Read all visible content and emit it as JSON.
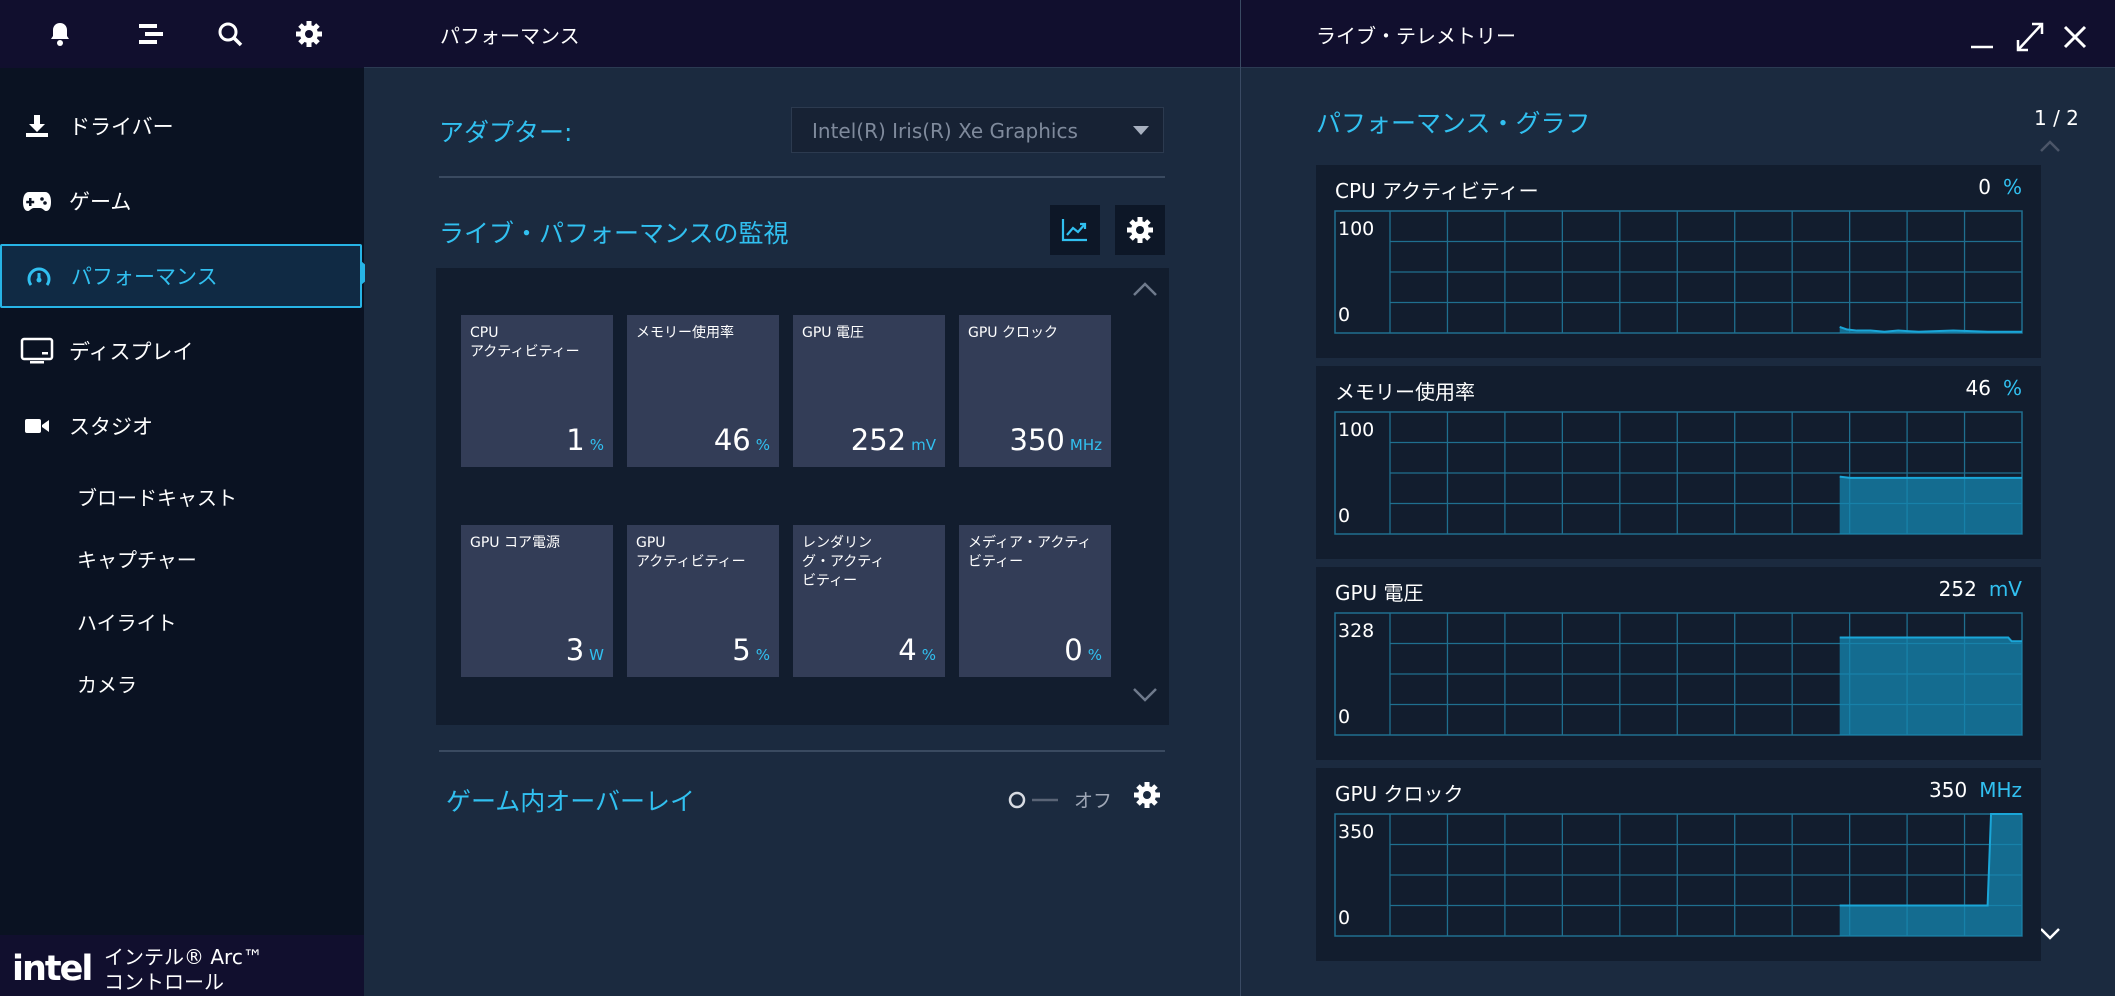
{
  "top_icons": [
    "bell-icon",
    "menu-icon",
    "search-icon",
    "gear-icon"
  ],
  "sidebar": {
    "items": [
      {
        "label": "ドライバー",
        "icon": "download-icon"
      },
      {
        "label": "ゲーム",
        "icon": "gamepad-icon"
      },
      {
        "label": "パフォーマンス",
        "icon": "gauge-icon",
        "active": true
      },
      {
        "label": "ディスプレイ",
        "icon": "monitor-icon"
      },
      {
        "label": "スタジオ",
        "icon": "camera-icon"
      }
    ],
    "sub_items": [
      "ブロードキャスト",
      "キャプチャー",
      "ハイライト",
      "カメラ"
    ],
    "brand": {
      "logo": "intel",
      "line1": "インテル® Arc™",
      "line2": "コントロール"
    }
  },
  "middle": {
    "header_title": "パフォーマンス",
    "adapter_label": "アダプター:",
    "adapter_value": "Intel(R) Iris(R) Xe Graphics",
    "monitor_title": "ライブ・パフォーマンスの監視",
    "tiles": [
      {
        "label": "CPU\nアクティビティー",
        "value": "1",
        "unit": "%"
      },
      {
        "label": "メモリー使用率",
        "value": "46",
        "unit": "%"
      },
      {
        "label": "GPU 電圧",
        "value": "252",
        "unit": "mV"
      },
      {
        "label": "GPU クロック",
        "value": "350",
        "unit": "MHz"
      },
      {
        "label": "GPU コア電源",
        "value": "3",
        "unit": "W"
      },
      {
        "label": "GPU\nアクティビティー",
        "value": "5",
        "unit": "%"
      },
      {
        "label": "レンダリン\nグ・アクティ\nビティー",
        "value": "4",
        "unit": "%"
      },
      {
        "label": "メディア・アクティ\nビティー",
        "value": "0",
        "unit": "%"
      }
    ],
    "overlay_title": "ゲーム内オーバーレイ",
    "overlay_state": "オフ"
  },
  "right": {
    "header_title": "ライブ・テレメトリー",
    "graph_title": "パフォーマンス・グラフ",
    "page_indicator": "1 / 2"
  },
  "colors": {
    "accent": "#31c0f0",
    "sidebar_bg": "#0a1222",
    "header_bg": "#110f2e",
    "panel_bg": "#1b2a3f",
    "tile_bg": "#333d57",
    "card_bg": "#121d2e",
    "grid": "#1f6f8f",
    "fill": "#1687b1"
  },
  "chart_data": [
    {
      "type": "area",
      "title": "CPU アクティビティー",
      "current": "0",
      "unit": "%",
      "ylim": [
        0,
        100
      ],
      "yticks": [
        "100",
        "0"
      ],
      "grid": true,
      "x": [
        0.735,
        0.745,
        0.76,
        0.78,
        0.8,
        0.82,
        0.85,
        0.9,
        0.95,
        1.0
      ],
      "values": [
        5,
        3,
        2,
        2,
        1,
        2,
        1,
        2,
        1,
        1
      ]
    },
    {
      "type": "area",
      "title": "メモリー使用率",
      "current": "46",
      "unit": "%",
      "ylim": [
        0,
        100
      ],
      "yticks": [
        "100",
        "0"
      ],
      "grid": true,
      "x": [
        0.735,
        0.75,
        1.0
      ],
      "values": [
        47,
        46,
        46
      ]
    },
    {
      "type": "area",
      "title": "GPU 電圧",
      "current": "252",
      "unit": "mV",
      "ylim": [
        0,
        328
      ],
      "yticks": [
        "328",
        "0"
      ],
      "grid": true,
      "x": [
        0.735,
        0.98,
        0.985,
        1.0
      ],
      "values": [
        262,
        262,
        252,
        252
      ]
    },
    {
      "type": "area",
      "title": "GPU クロック",
      "current": "350",
      "unit": "MHz",
      "ylim": [
        0,
        400
      ],
      "yticks": [
        "350",
        "0"
      ],
      "grid": true,
      "x": [
        0.735,
        0.95,
        0.955,
        1.0
      ],
      "values": [
        100,
        100,
        400,
        400
      ]
    }
  ]
}
